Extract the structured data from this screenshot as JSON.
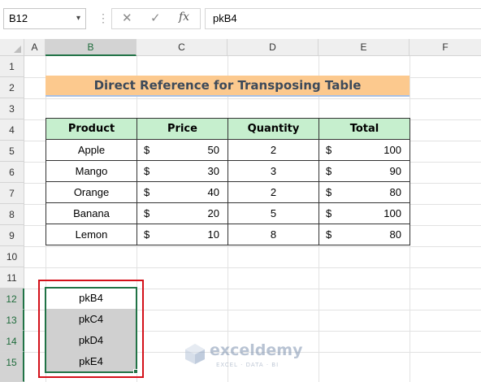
{
  "formula_bar": {
    "name_box": "B12",
    "name_box_arrow": "▾",
    "cancel_glyph": "✕",
    "enter_glyph": "✓",
    "fx_label": "fx",
    "formula": "pkB4"
  },
  "columns": [
    "A",
    "B",
    "C",
    "D",
    "E",
    "F"
  ],
  "rows": [
    "1",
    "2",
    "3",
    "4",
    "5",
    "6",
    "7",
    "8",
    "9",
    "10",
    "11",
    "12",
    "13",
    "14",
    "15"
  ],
  "selected_column": "B",
  "selected_rows": [
    "12",
    "13",
    "14",
    "15"
  ],
  "title": "Direct Reference for Transposing Table",
  "table": {
    "headers": [
      "Product",
      "Price",
      "Quantity",
      "Total"
    ],
    "rows": [
      {
        "product": "Apple",
        "price_symbol": "$",
        "price": "50",
        "quantity": "2",
        "total_symbol": "$",
        "total": "100"
      },
      {
        "product": "Mango",
        "price_symbol": "$",
        "price": "30",
        "quantity": "3",
        "total_symbol": "$",
        "total": "90"
      },
      {
        "product": "Orange",
        "price_symbol": "$",
        "price": "40",
        "quantity": "2",
        "total_symbol": "$",
        "total": "80"
      },
      {
        "product": "Banana",
        "price_symbol": "$",
        "price": "20",
        "quantity": "5",
        "total_symbol": "$",
        "total": "100"
      },
      {
        "product": "Lemon",
        "price_symbol": "$",
        "price": "10",
        "quantity": "8",
        "total_symbol": "$",
        "total": "80"
      }
    ]
  },
  "result_cells": [
    "pkB4",
    "pkC4",
    "pkD4",
    "pkE4"
  ],
  "watermark": {
    "name": "exceldemy",
    "tagline": "EXCEL · DATA · BI"
  },
  "colors": {
    "title_fill": "#fcc98e",
    "header_fill": "#c6efce",
    "highlight_box": "#d4111a",
    "selection": "#217346",
    "shaded_cells": "#d0d0d0"
  }
}
